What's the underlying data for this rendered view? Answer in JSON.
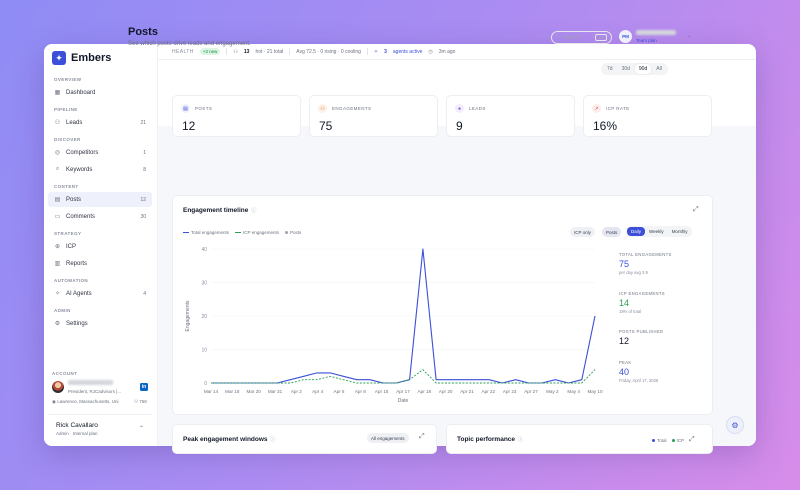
{
  "brand": {
    "name": "Embers",
    "logo_icon": "spark-icon",
    "accent": "#3b4fd8"
  },
  "sidebar": {
    "sections": [
      {
        "label": "OVERVIEW",
        "items": [
          {
            "label": "Dashboard",
            "icon": "dashboard-icon",
            "count": ""
          }
        ]
      },
      {
        "label": "PIPELINE",
        "items": [
          {
            "label": "Leads",
            "icon": "users-icon",
            "count": "21"
          }
        ]
      },
      {
        "label": "DISCOVER",
        "items": [
          {
            "label": "Competitors",
            "icon": "target-icon",
            "count": "1"
          },
          {
            "label": "Keywords",
            "icon": "search-icon",
            "count": "8"
          }
        ]
      },
      {
        "label": "CONTENT",
        "items": [
          {
            "label": "Posts",
            "icon": "document-icon",
            "count": "12",
            "active": true
          },
          {
            "label": "Comments",
            "icon": "comment-icon",
            "count": "30"
          }
        ]
      },
      {
        "label": "STRATEGY",
        "items": [
          {
            "label": "ICP",
            "icon": "crosshair-icon",
            "count": ""
          },
          {
            "label": "Reports",
            "icon": "chart-icon",
            "count": ""
          }
        ]
      },
      {
        "label": "AUTOMATION",
        "items": [
          {
            "label": "AI Agents",
            "icon": "sparkles-icon",
            "count": "4"
          }
        ]
      },
      {
        "label": "ADMIN",
        "items": [
          {
            "label": "Settings",
            "icon": "gear-icon",
            "count": ""
          }
        ]
      }
    ],
    "account": {
      "label": "ACCOUNT",
      "title": "President, RJCadvisors |...",
      "location": "Lawrence, Massachusetts, Uni",
      "connections": "758"
    },
    "user": {
      "name": "Rick Cavallaro",
      "plan": "Admin · Internal plan"
    }
  },
  "statusbar": {
    "health_label": "HEALTH",
    "health_badge": "+3 new",
    "hot_count": "13",
    "hot_text": "hot · 21 total",
    "avg_text": "Avg 72.5 · 0 rising · 0 cooling",
    "agents_count": "3",
    "agents_text": "agents active",
    "time_text": "3m ago"
  },
  "header": {
    "title": "Posts",
    "subtitle": "See which posts drive leads and engagement.",
    "search_placeholder": "Search...",
    "search_kbd": "⌘K",
    "team_initials": "PM",
    "team_plan": "Team plan"
  },
  "range_buttons": [
    "7d",
    "30d",
    "90d",
    "All"
  ],
  "range_active": "90d",
  "kpis": [
    {
      "label": "POSTS",
      "value": "12",
      "icon": "document-icon",
      "color": "#3b4fd8",
      "bg": "#eef1fb"
    },
    {
      "label": "ENGAGEMENTS",
      "value": "75",
      "icon": "users-icon",
      "color": "#e07a2e",
      "bg": "#fdf0e6"
    },
    {
      "label": "LEADS",
      "value": "9",
      "icon": "leads-icon",
      "color": "#7c4ddb",
      "bg": "#f2ecfc"
    },
    {
      "label": "ICP RATE",
      "value": "16%",
      "icon": "trend-up-icon",
      "color": "#d64545",
      "bg": "#fcecec"
    }
  ],
  "engagement": {
    "title": "Engagement timeline",
    "legend": {
      "total": "Total engagements",
      "icp": "ICP engagements",
      "posts": "Posts"
    },
    "icp_only_chip": "ICP only",
    "posts_chip": "Posts",
    "granularity": [
      "Daily",
      "Weekly",
      "Monthly"
    ],
    "granularity_active": "Daily",
    "stats": [
      {
        "label": "TOTAL ENGAGEMENTS",
        "value": "75",
        "sub": "per day avg 3.9",
        "color": "#3b4fd8"
      },
      {
        "label": "ICP ENGAGEMENTS",
        "value": "14",
        "sub": "19% of total",
        "color": "#2f9e55"
      },
      {
        "label": "POSTS PUBLISHED",
        "value": "12",
        "sub": "",
        "color": "#111827"
      },
      {
        "label": "PEAK",
        "value": "40",
        "sub": "Friday, April 17, 2026",
        "color": "#3b4fd8"
      }
    ]
  },
  "chart_data": {
    "type": "line",
    "x": [
      "Mar 14",
      "Mar 16",
      "Mar 18",
      "Mar 20",
      "Mar 22",
      "Mar 24",
      "Mar 26",
      "Mar 28",
      "Mar 30",
      "Apr 1",
      "Apr 3",
      "Apr 5",
      "Apr 7",
      "Apr 9",
      "Apr 11",
      "Apr 13",
      "Apr 15",
      "Apr 17",
      "Apr 19",
      "Apr 21",
      "Apr 23",
      "Apr 25",
      "Apr 27",
      "Apr 29",
      "May 1",
      "May 3",
      "May 5",
      "May 7",
      "May 9",
      "May 11"
    ],
    "xticks": [
      "Mar 14",
      "Mar 18",
      "Mar 20",
      "Mar 31",
      "Apr 2",
      "Apr 4",
      "Apr 6",
      "Apr 8",
      "Apr 15",
      "Apr 17",
      "Apr 18",
      "Apr 20",
      "Apr 21",
      "Apr 22",
      "Apr 23",
      "Apr 27",
      "May 2",
      "May 4",
      "May 10"
    ],
    "series": [
      {
        "name": "Total engagements",
        "color": "#3b4fd8",
        "values": [
          0,
          0,
          0,
          0,
          0,
          0,
          1,
          2,
          3,
          3,
          2,
          1,
          1,
          0,
          0,
          1,
          40,
          1,
          1,
          1,
          1,
          1,
          0,
          1,
          0,
          0,
          1,
          0,
          1,
          20
        ]
      },
      {
        "name": "ICP engagements",
        "color": "#2f9e55",
        "values": [
          0,
          0,
          0,
          0,
          0,
          0,
          0,
          1,
          1,
          2,
          1,
          0,
          0,
          0,
          0,
          1,
          4,
          0,
          0,
          0,
          0,
          0,
          0,
          0,
          0,
          0,
          0,
          0,
          0,
          4
        ]
      }
    ],
    "xlabel": "Date",
    "ylabel": "Engagements",
    "yticks": [
      0,
      10,
      20,
      30,
      40
    ],
    "ylim": [
      0,
      40
    ]
  },
  "bottom": {
    "peak_title": "Peak engagement windows",
    "peak_chip": "All engagements",
    "topic_title": "Topic performance",
    "topic_legend_total": "Total",
    "topic_legend_icp": "ICP"
  }
}
